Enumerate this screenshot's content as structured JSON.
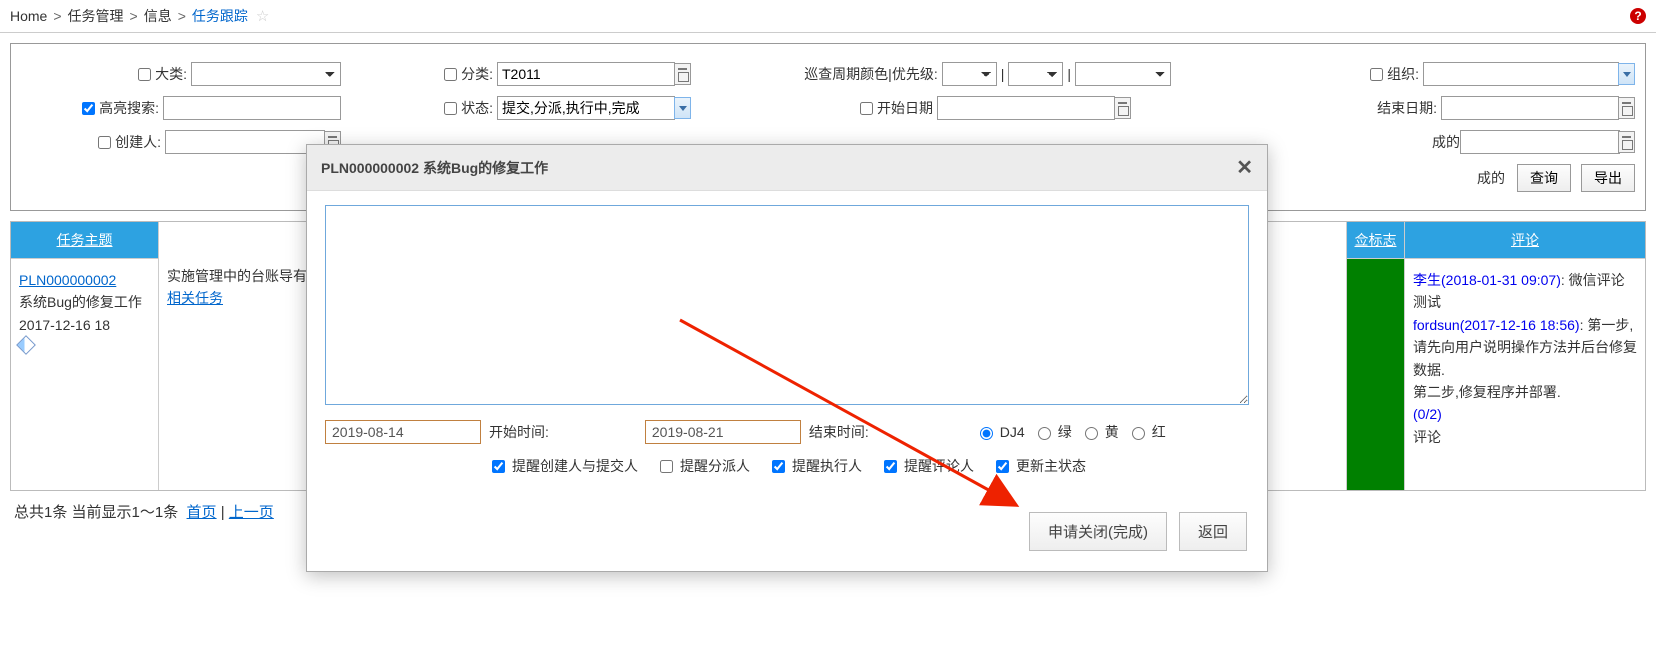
{
  "breadcrumb": {
    "home": "Home",
    "l1": "任务管理",
    "l2": "信息",
    "l3": "任务跟踪"
  },
  "filters": {
    "category_label": "大类:",
    "subcategory_label": "分类:",
    "subcategory_value": "T2011",
    "priority_label": "巡查周期颜色|优先级:",
    "org_label": "组织:",
    "highlight_label": "高亮搜索:",
    "status_label": "状态:",
    "status_value": "提交,分派,执行中,完成",
    "startdate_label": "开始日期",
    "enddate_label": "结束日期:",
    "creator_label": "创建人:",
    "row3_tail_label": "成的",
    "query_btn": "查询",
    "export_btn": "导出"
  },
  "table": {
    "headers": {
      "subject": "任务主题",
      "flag": "佥标志",
      "comment": "评论"
    },
    "row": {
      "id": "PLN000000002",
      "title": "系统Bug的修复工作",
      "date": "2017-12-16 18",
      "desc": "实施管理中的台账导有，但是导入后就变",
      "related": "相关任务",
      "comments": {
        "c1_author": "李生(2018-01-31 09:07)",
        "c1_text": ": 微信评论测试",
        "c2_author": "fordsun(2017-12-16 18:56)",
        "c2_text": ": 第一步,请先向用户说明操作方法并后台修复数据.",
        "c3_text": "第二步,修复程序并部署.",
        "count": "(0/2)",
        "action": "评论"
      }
    }
  },
  "pager": {
    "summary": "总共1条 当前显示1～1条",
    "first": "首页",
    "prev": "上一页"
  },
  "dialog": {
    "title": "PLN000000002 系统Bug的修复工作",
    "start_date": "2019-08-14",
    "start_label": "开始时间:",
    "end_date": "2019-08-21",
    "end_label": "结束时间:",
    "radios": {
      "dj4": "DJ4",
      "green": "绿",
      "yellow": "黄",
      "red": "红"
    },
    "checks": {
      "notify_creator": "提醒创建人与提交人",
      "notify_assign": "提醒分派人",
      "notify_exec": "提醒执行人",
      "notify_comment": "提醒评论人",
      "update_status": "更新主状态"
    },
    "btn_apply": "申请关闭(完成)",
    "btn_back": "返回"
  }
}
